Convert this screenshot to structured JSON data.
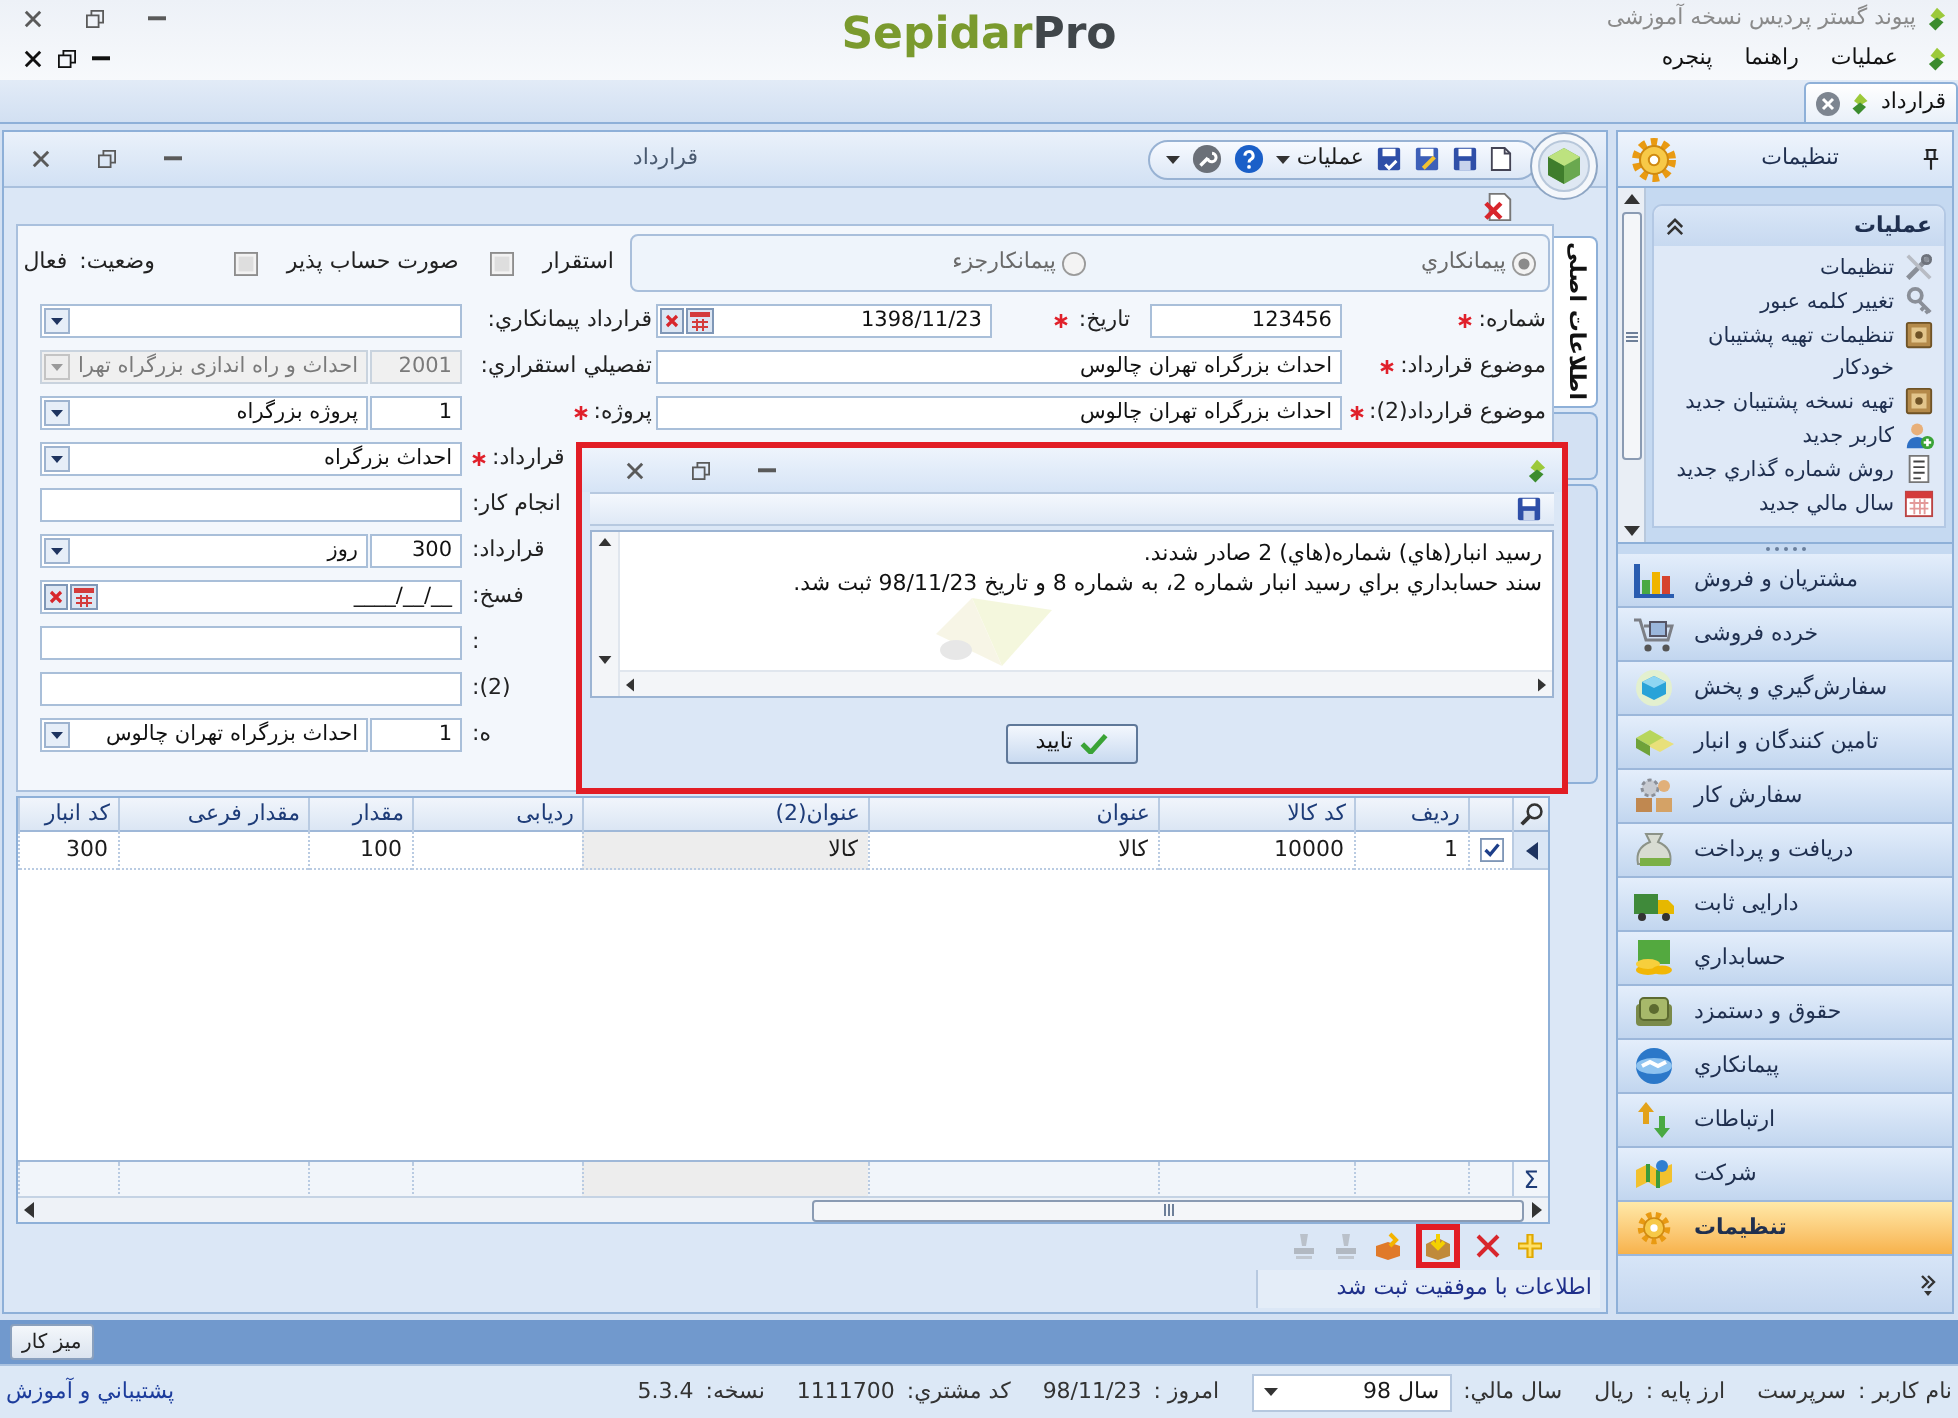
{
  "app": {
    "title": "پیوند گستر پردیس نسخه آموزشی",
    "logo": {
      "name": "Sepidar",
      "suffix": "Pro"
    }
  },
  "menu": [
    "عملیات",
    "راهنما",
    "پنجره"
  ],
  "document_tabs": [
    {
      "label": "قرارداد",
      "selected": true
    }
  ],
  "form": {
    "title": "قرارداد",
    "toolbar_menu": "عملیات",
    "vertical_tabs": [
      {
        "label": "اطلاعات اصلی",
        "selected": true
      },
      {
        "selected": false
      },
      {
        "selected": false
      }
    ],
    "contract_types": [
      {
        "label": "پیمانکاري",
        "selected": true
      },
      {
        "label": "پیمانکارجزء",
        "selected": false
      }
    ],
    "options": [
      {
        "label": "استقرار",
        "checked": false
      },
      {
        "label": "صورت حساب پذیر",
        "checked": false
      }
    ],
    "status": {
      "label": "وضعیت:",
      "value": "فعال"
    },
    "main_fields": [
      {
        "label": "شماره:",
        "required": true,
        "kind": "text",
        "value": "123456"
      },
      {
        "label": "تاریخ:",
        "required": true,
        "kind": "date",
        "value": "1398/11/23"
      },
      {
        "label": "موضوع قرارداد:",
        "required": true,
        "kind": "text",
        "value": "احداث بزرگراه تهران چالوس"
      },
      {
        "label": "موضوع قرارداد(2):",
        "required": true,
        "kind": "text",
        "value": "احداث بزرگراه تهران چالوس"
      }
    ],
    "side_fields": [
      {
        "label": "قرارداد پیمانکاري:",
        "required": false,
        "disabled": false,
        "kind": "combo"
      },
      {
        "label": "تفصیلي استقراري:",
        "required": false,
        "disabled": true,
        "kind": "pair",
        "code": "2001",
        "value": "احداث و راه اندازی بزرگراه تهرا"
      },
      {
        "label": "پروژه:",
        "required": true,
        "disabled": false,
        "kind": "pair",
        "code": "1",
        "value": "پروژه بزرگراه"
      },
      {
        "label": "قرارداد:",
        "required": true,
        "disabled": false,
        "kind": "combo",
        "value": "احداث بزرگراه"
      },
      {
        "label": "انجام کار:",
        "required": false,
        "disabled": false,
        "kind": "text"
      },
      {
        "label": "قرارداد:",
        "required": false,
        "disabled": false,
        "kind": "pair",
        "code": "300",
        "value": "روز"
      },
      {
        "label": "فسخ:",
        "required": false,
        "disabled": false,
        "kind": "date",
        "value": "____/__/__"
      },
      {
        "label": ":",
        "required": false,
        "disabled": false,
        "kind": "text"
      },
      {
        "label": "(2):",
        "required": false,
        "disabled": false,
        "kind": "text"
      },
      {
        "label": "ه:",
        "required": false,
        "disabled": false,
        "kind": "pair",
        "code": "1",
        "value": "احداث بزرگراه تهران چالوس"
      }
    ]
  },
  "dialog": {
    "highlighted": true,
    "lines": [
      "رسید انبار(هاي) شماره(هاي) 2 صادر شدند.",
      "سند حسابداري براي رسيد انبار شماره 2، به شماره 8 و تاريخ 98/11/23 ثبت شد."
    ],
    "ok_button": "تایید"
  },
  "table": {
    "columns": [
      {
        "label": "ردیف",
        "readonly": false
      },
      {
        "label": "کد کالا",
        "readonly": false
      },
      {
        "label": "عنوان",
        "readonly": false
      },
      {
        "label": "عنوان(2)",
        "readonly": true
      },
      {
        "label": "ردیابی",
        "readonly": false
      },
      {
        "label": "مقدار",
        "readonly": false
      },
      {
        "label": "مقدار فرعی",
        "readonly": false
      },
      {
        "label": "کد انبار",
        "readonly": false
      }
    ],
    "rows": [
      {
        "selected": true,
        "checked": true,
        "cells": [
          "1",
          "10000",
          "کالا",
          "کالا",
          null,
          "100",
          null,
          "300"
        ]
      }
    ],
    "footer": "Σ"
  },
  "bottom_toolbar": [
    {
      "disabled": false,
      "highlighted": false
    },
    {
      "disabled": false,
      "highlighted": false
    },
    {
      "disabled": false,
      "highlighted": true
    },
    {
      "disabled": false,
      "highlighted": false
    },
    {
      "disabled": true,
      "highlighted": false
    },
    {
      "disabled": true,
      "highlighted": false
    }
  ],
  "message": "اطلاعات با موفقیت ثبت شد",
  "taskbar": [
    "میز کار"
  ],
  "status_bar": {
    "fields": [
      {
        "label": "نام کاربر :",
        "value": "سرپرست",
        "kind": "text"
      },
      {
        "label": "ارز پایه :",
        "value": "ریال",
        "kind": "text"
      },
      {
        "label": "سال مالي:",
        "value": "سال 98",
        "kind": "dropdown"
      },
      {
        "label": "امروز :",
        "value": "98/11/23",
        "kind": "text"
      },
      {
        "label": "کد مشتري:",
        "value": "1111700",
        "kind": "text"
      },
      {
        "label": "نسخه:",
        "value": "5.3.4",
        "kind": "text"
      }
    ],
    "link": "پشتيباني و آموزش"
  },
  "sidebar": {
    "title": "تنظیمات",
    "group": {
      "title": "عملیات",
      "expanded": true,
      "items": [
        "تنظیمات",
        "تغییر کلمه عبور",
        "تنظیمات تهیه پشتیبان خودکار",
        "تهیه نسخه پشتیبان جدید",
        "کاربر جدید",
        "روش شماره گذاري جديد",
        "سال مالي جديد"
      ]
    },
    "modules": [
      {
        "label": "مشتریان و فروش",
        "selected": false
      },
      {
        "label": "خرده فروشی",
        "selected": false
      },
      {
        "label": "سفارش‌گیري و پخش",
        "selected": false
      },
      {
        "label": "تامین کنندگان و انبار",
        "selected": false
      },
      {
        "label": "سفارش کار",
        "selected": false
      },
      {
        "label": "دریافت و پرداخت",
        "selected": false
      },
      {
        "label": "دارایی ثابت",
        "selected": false
      },
      {
        "label": "حسابداري",
        "selected": false
      },
      {
        "label": "حقوق و دستمزد",
        "selected": false
      },
      {
        "label": "پیمانکاري",
        "selected": false
      },
      {
        "label": "ارتباطات",
        "selected": false
      },
      {
        "label": "شرکت",
        "selected": false
      },
      {
        "label": "تنظیمات",
        "selected": true
      }
    ]
  }
}
